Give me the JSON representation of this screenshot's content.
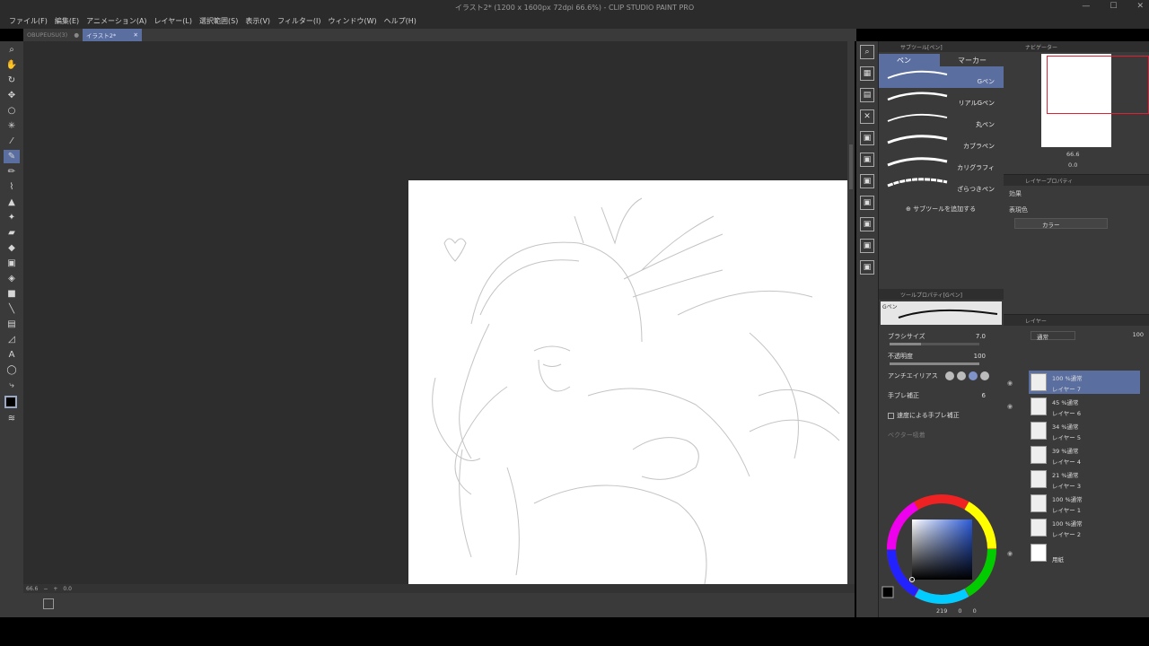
{
  "window": {
    "title": "イラスト2* (1200 x 1600px 72dpi 66.6%) - CLIP STUDIO PAINT PRO"
  },
  "menu": [
    "ファイル(F)",
    "編集(E)",
    "アニメーション(A)",
    "レイヤー(L)",
    "選択範囲(S)",
    "表示(V)",
    "フィルター(I)",
    "ウィンドウ(W)",
    "ヘルプ(H)"
  ],
  "tabs": [
    {
      "label": "OBUPEUSU(3)"
    },
    {
      "label": "イラスト2*"
    }
  ],
  "status": {
    "zoom": "66.6",
    "rotation": "0.0"
  },
  "subtool": {
    "header": "サブツール[ペン]",
    "tab_pen": "ペン",
    "tab_marker": "マーカー",
    "brushes": [
      "Gペン",
      "リアルGペン",
      "丸ペン",
      "カブラペン",
      "カリグラフィ",
      "ざらつきペン"
    ],
    "add_label": "サブツールを追加する"
  },
  "toolprop": {
    "header": "ツールプロパティ[Gペン]",
    "preview_label": "Gペン",
    "brush_size_label": "ブラシサイズ",
    "brush_size": "7.0",
    "opacity_label": "不透明度",
    "opacity": "100",
    "antialias_label": "アンチエイリアス",
    "stabilization_label": "手ブレ補正",
    "stabilization": "6",
    "speed_label": "速度による手ブレ補正",
    "vector_label": "ベクター吸着"
  },
  "colorwheel": {
    "h": "219",
    "s": "0",
    "v": "0"
  },
  "navigator": {
    "header": "ナビゲーター",
    "zoom": "66.6",
    "rotation": "0.0"
  },
  "layerprop": {
    "header": "レイヤープロパティ",
    "effect_label": "効果",
    "expression_label": "表現色",
    "expression_value": "カラー"
  },
  "layerpanel": {
    "header": "レイヤー",
    "blend": "通常",
    "opacity": "100",
    "layers": [
      {
        "mode": "100 %通常",
        "name": "レイヤー 7"
      },
      {
        "mode": "45 %通常",
        "name": "レイヤー 6"
      },
      {
        "mode": "34 %通常",
        "name": "レイヤー 5"
      },
      {
        "mode": "39 %通常",
        "name": "レイヤー 4"
      },
      {
        "mode": "21 %通常",
        "name": "レイヤー 3"
      },
      {
        "mode": "100 %通常",
        "name": "レイヤー 1"
      },
      {
        "mode": "100 %通常",
        "name": "レイヤー 2"
      },
      {
        "mode": "",
        "name": "用紙"
      }
    ]
  }
}
